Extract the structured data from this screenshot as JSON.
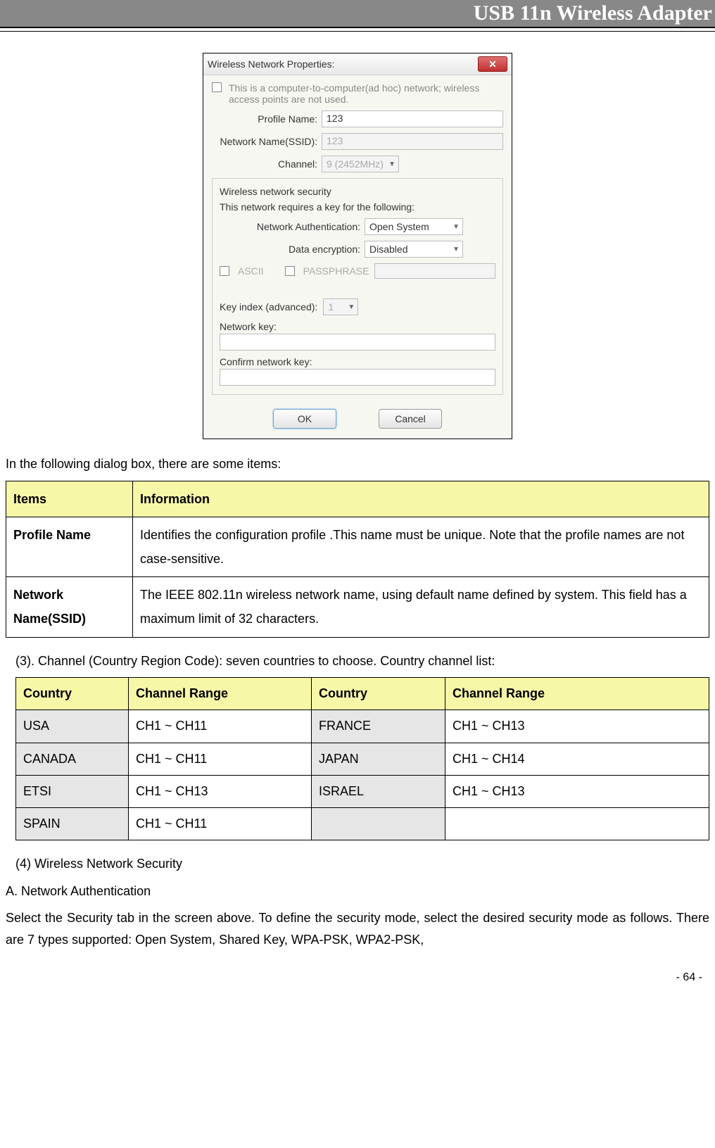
{
  "header": {
    "title": "USB 11n Wireless Adapter"
  },
  "dialog": {
    "title": "Wireless Network Properties:",
    "adhoc_text": "This is a computer-to-computer(ad hoc) network; wireless access points are not used.",
    "profile_label": "Profile Name:",
    "profile_value": "123",
    "ssid_label": "Network Name(SSID):",
    "ssid_value": "123",
    "channel_label": "Channel:",
    "channel_value": "9 (2452MHz)",
    "security_legend": "Wireless network security",
    "security_text": "This network requires a key for the following:",
    "auth_label": "Network Authentication:",
    "auth_value": "Open System",
    "enc_label": "Data encryption:",
    "enc_value": "Disabled",
    "ascii_label": "ASCII",
    "passphrase_label": "PASSPHRASE",
    "keyindex_label": "Key index (advanced):",
    "keyindex_value": "1",
    "netkey_label": "Network key:",
    "confirmkey_label": "Confirm network key:",
    "ok": "OK",
    "cancel": "Cancel"
  },
  "text": {
    "intro": "In the following dialog box, there are some items:",
    "channel_intro": "(3). Channel (Country Region Code): seven countries to choose. Country channel list:",
    "sec_heading": "(4) Wireless Network Security",
    "auth_a": "A. Network Authentication",
    "auth_desc": "Select the Security tab in the screen above. To define the security mode, select the desired security mode as follows. There are 7 types supported: Open System, Shared Key, WPA-PSK, WPA2-PSK,"
  },
  "items_table": {
    "h1": "Items",
    "h2": "Information",
    "rows": [
      {
        "item": "Profile Name",
        "info": "Identifies the configuration profile .This name must be unique. Note that the profile names are not case-sensitive."
      },
      {
        "item": "Network Name(SSID)",
        "info": "The IEEE 802.11n wireless network name, using default name defined by system. This field has a maximum limit of 32 characters."
      }
    ]
  },
  "country_table": {
    "h1": "Country",
    "h2": "Channel Range",
    "h3": "Country",
    "h4": "Channel Range",
    "rows": [
      {
        "c1": "USA",
        "r1": "CH1 ~ CH11",
        "c2": "FRANCE",
        "r2": "CH1 ~ CH13"
      },
      {
        "c1": "CANADA",
        "r1": "CH1 ~ CH11",
        "c2": "JAPAN",
        "r2": "CH1 ~ CH14"
      },
      {
        "c1": "ETSI",
        "r1": "CH1 ~ CH13",
        "c2": "ISRAEL",
        "r2": "CH1 ~ CH13"
      },
      {
        "c1": "SPAIN",
        "r1": "CH1 ~ CH11",
        "c2": "",
        "r2": ""
      }
    ]
  },
  "footer": {
    "page": "- 64 -"
  }
}
